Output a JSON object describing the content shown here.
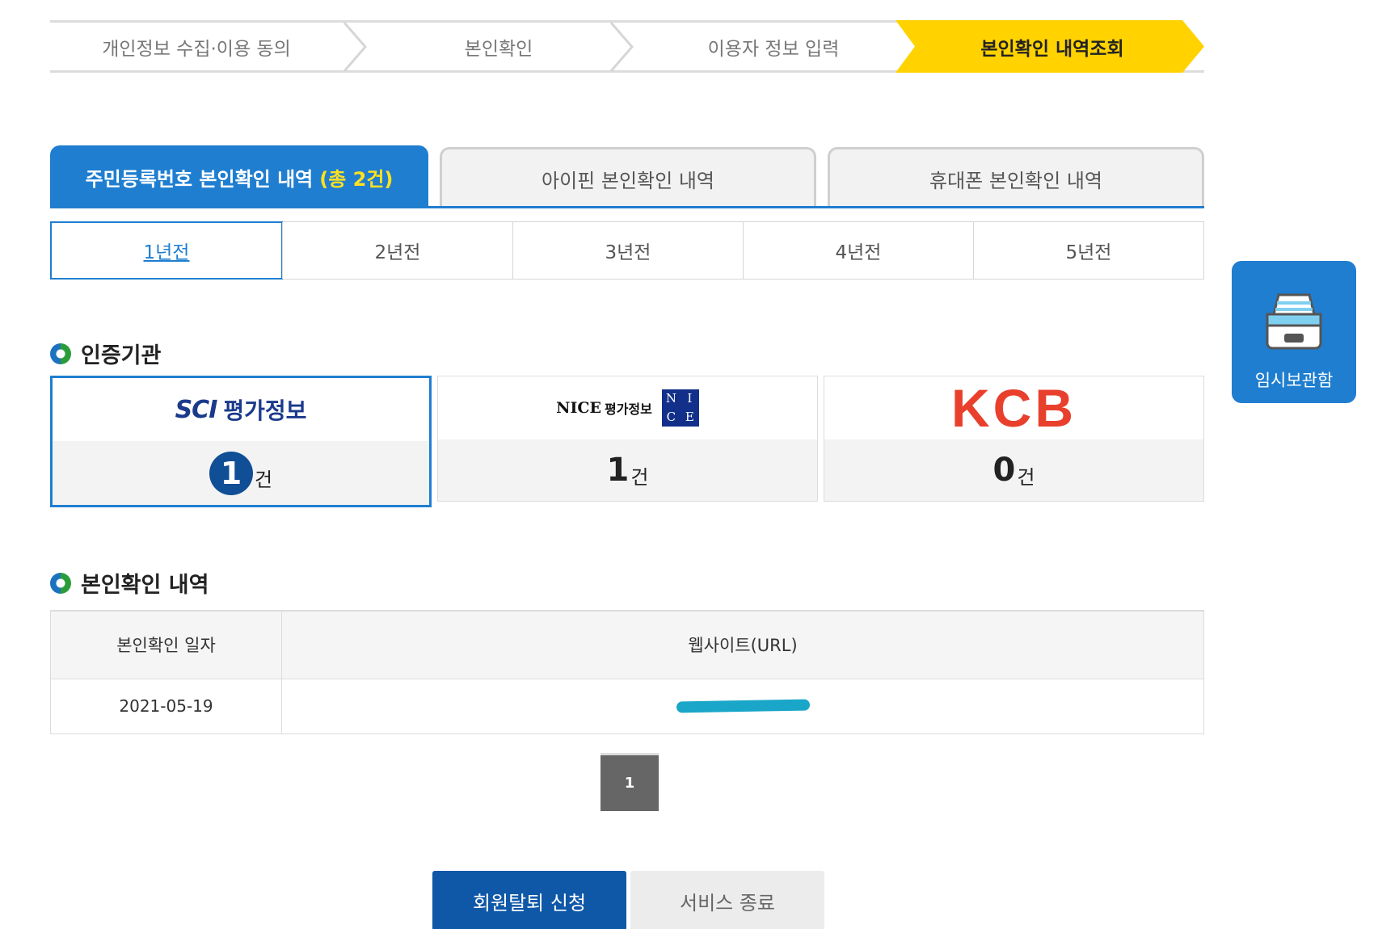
{
  "steps": {
    "step1": "개인정보 수집·이용 동의",
    "step2": "본인확인",
    "step3": "이용자 정보 입력",
    "step4": "본인확인 내역조회"
  },
  "tabs": {
    "resident_label": "주민등록번호 본인확인 내역",
    "resident_count": "(총 2건)",
    "ipin_label": "아이핀 본인확인 내역",
    "phone_label": "휴대폰 본인확인 내역"
  },
  "years": [
    "1년전",
    "2년전",
    "3년전",
    "4년전",
    "5년전"
  ],
  "agencies": {
    "title": "인증기관",
    "sci": {
      "logo_a": "SCI",
      "logo_b": "평가정보",
      "count": "1",
      "unit": "건"
    },
    "nice": {
      "logo_a": "NICE",
      "logo_b": "평가정보",
      "box": [
        "N",
        "I",
        "C",
        "E"
      ],
      "count": "1",
      "unit": "건"
    },
    "kcb": {
      "logo": "KCB",
      "count": "0",
      "unit": "건"
    }
  },
  "history": {
    "title": "본인확인 내역",
    "col_date": "본인확인 일자",
    "col_url": "웹사이트(URL)",
    "rows": [
      {
        "date": "2021-05-19"
      }
    ]
  },
  "pager": {
    "current": "1"
  },
  "buttons": {
    "withdraw": "회원탈퇴 신청",
    "end": "서비스 종료"
  },
  "side": {
    "label": "임시보관함"
  },
  "colors": {
    "accent": "#1f7ed0",
    "step_active": "#ffd200",
    "count_highlight": "#ffe11f",
    "kcb_red": "#e8402d"
  }
}
